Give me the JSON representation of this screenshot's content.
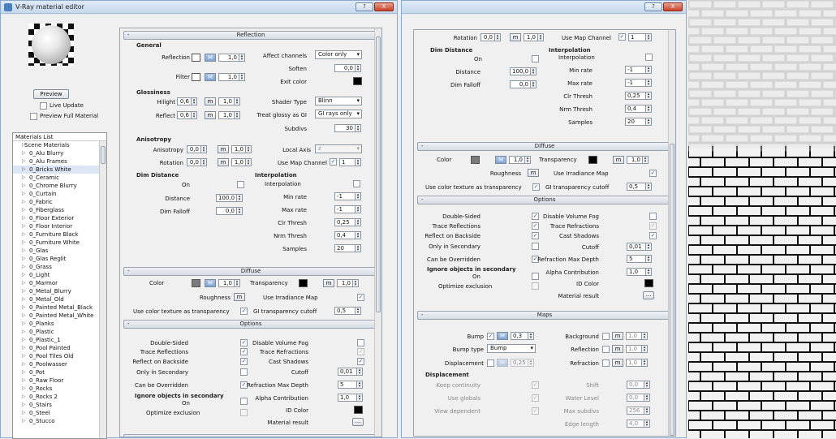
{
  "window1": {
    "title": "V-Ray material editor",
    "help": "?",
    "close": "X"
  },
  "window2": {
    "help": "?",
    "close": "X"
  },
  "preview": {
    "button": "Preview",
    "live_update": "Live Update",
    "preview_full": "Preview Full Material"
  },
  "materials": {
    "title": "Materials List",
    "root": "Scene Materials",
    "items": [
      "0_Alu Blurry",
      "0_Alu Frames",
      "0_Bricks White",
      "0_Ceramic",
      "0_Chrome Blurry",
      "0_Curtain",
      "0_Fabric",
      "0_Fiberglass",
      "0_Floor Exterior",
      "0_Floor Interior",
      "0_Furniture Black",
      "0_Furniture White",
      "0_Glas",
      "0_Glas Reglit",
      "0_Grass",
      "0_Light",
      "0_Marmor",
      "0_Metal_Blurry",
      "0_Metal_Old",
      "0_Painted Metal_Black",
      "0_Painted Metal_White",
      "0_Planks",
      "0_Plastic",
      "0_Plastic_1",
      "0_Pool Painted",
      "0_Pool Tiles Old",
      "0_Poolwasser",
      "0_Pot",
      "0_Raw Floor",
      "0_Rocks",
      "0_Rocks 2",
      "0_Stairs",
      "0_Steel",
      "0_Stucco"
    ],
    "selected": 2
  },
  "reflection": {
    "header": "Reflection",
    "general": "General",
    "reflection": "Reflection",
    "filter": "Filter",
    "m": "M",
    "m_lower": "m",
    "val_1": "1,0",
    "affect_channels": "Affect channels",
    "affect_value": "Color only",
    "soften": "Soften",
    "soften_val": "0,0",
    "exit_color": "Exit color",
    "glossiness": "Glossiness",
    "hilight": "Hilight",
    "hilight_val": "0,6",
    "reflect": "Reflect",
    "reflect_val": "0,6",
    "shader_type": "Shader Type",
    "shader_val": "Blinn",
    "treat_glossy": "Treat glossy as GI",
    "treat_val": "GI rays only",
    "subdivs": "Subdivs",
    "subdivs_val": "30",
    "anisotropy_group": "Anisotropy",
    "anisotropy": "Anisotropy",
    "rotation": "Rotation",
    "zero": "0,0",
    "local_axis": "Local Axis",
    "local_val": "z",
    "use_map_channel": "Use Map Channel",
    "map_ch_val": "1",
    "dim_distance": "Dim Distance",
    "on": "On",
    "distance": "Distance",
    "distance_val": "100,0",
    "dim_falloff": "Dim Falloff",
    "falloff_val": "0,0",
    "interpolation": "Interpolation",
    "interp": "Interpolation",
    "min_rate": "Min rate",
    "min_val": "-1",
    "max_rate": "Max rate",
    "max_val": "-1",
    "clr_thresh": "Clr Thresh",
    "clr_val": "0,25",
    "nrm_thresh": "Nrm Thresh",
    "nrm_val": "0,4",
    "samples": "Samples",
    "samples_val": "20"
  },
  "diffuse": {
    "header": "Diffuse",
    "color": "Color",
    "m": "M",
    "val": "1,0",
    "transparency": "Transparency",
    "m_lower": "m",
    "roughness": "Roughness",
    "use_irr": "Use Irradiance Map",
    "use_color_tex": "Use color texture as transparency",
    "gi_cutoff": "GI transparency cutoff",
    "gi_val": "0,5"
  },
  "options": {
    "header": "Options",
    "double_sided": "Double-Sided",
    "trace_refl": "Trace Reflections",
    "reflect_backside": "Reflect on Backside",
    "only_secondary": "Only in Secondary",
    "can_override": "Can be Overridden",
    "ignore": "Ignore objects in secondary",
    "on": "On",
    "optimize": "Optimize exclusion",
    "disable_fog": "Disable Volume Fog",
    "trace_refr": "Trace Refractions",
    "cast_shadows": "Cast Shadows",
    "cutoff": "Cutoff",
    "cutoff_val": "0,01",
    "refr_max_depth": "Refraction Max Depth",
    "depth_val": "5",
    "alpha": "Alpha Contribution",
    "alpha_val": "1,0",
    "id_color": "ID Color",
    "material_result": "Material result",
    "dots": "..."
  },
  "maps": {
    "header": "Maps",
    "bump": "Bump",
    "bump_val": "0,3",
    "m": "M",
    "bump_type": "Bump type",
    "bump_type_val": "Bump",
    "displacement": "Displacement",
    "disp_val": "0,25",
    "background": "Background",
    "reflection": "Reflection",
    "refraction": "Refraction",
    "m_lower": "m",
    "val": "1,0",
    "disp_group": "Displacement",
    "keep_cont": "Keep continuity",
    "use_globals": "Use globals",
    "view_dep": "View dependent",
    "shift": "Shift",
    "shift_val": "0,0",
    "water": "Water Level",
    "water_val": "0,0",
    "max_subdivs": "Max subdivs",
    "max_subdivs_val": "256",
    "edge_len": "Edge length",
    "edge_val": "4,0"
  },
  "colors": {
    "brick_light": "#f2f2f2",
    "brick_dark": "#1a1a1a",
    "swatch_gray": "#7a7a7a"
  }
}
